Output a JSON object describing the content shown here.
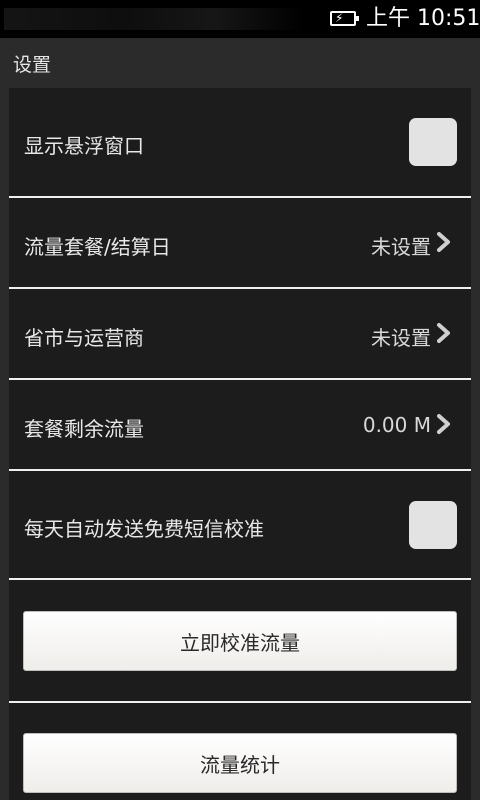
{
  "status_bar": {
    "time": "上午 10:51",
    "battery_icon": "battery-charging-icon"
  },
  "title": "设置",
  "settings": {
    "floating_window": {
      "label": "显示悬浮窗口",
      "checked": false
    },
    "plan_billing_day": {
      "label": "流量套餐/结算日",
      "value": "未设置"
    },
    "province_carrier": {
      "label": "省市与运营商",
      "value": "未设置"
    },
    "remaining_data": {
      "label": "套餐剩余流量",
      "value": "0.00 M"
    },
    "auto_sms_calibrate": {
      "label": "每天自动发送免费短信校准",
      "checked": false
    }
  },
  "buttons": {
    "calibrate_now": "立即校准流量",
    "traffic_stats": "流量统计"
  }
}
